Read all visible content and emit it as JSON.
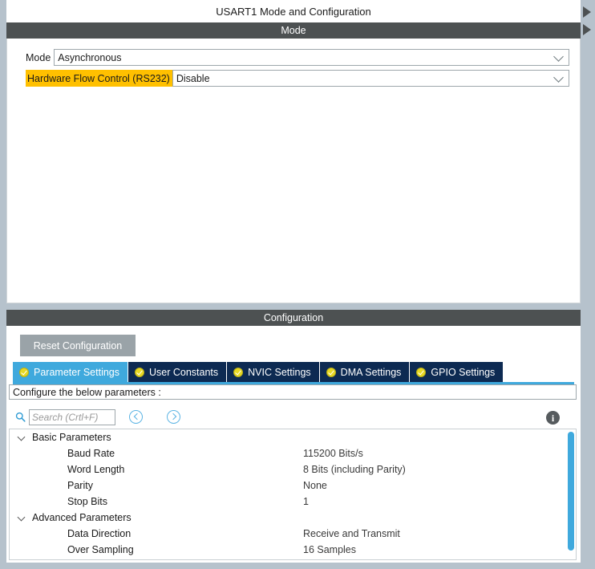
{
  "panel": {
    "title": "USART1 Mode and Configuration"
  },
  "mode_section": {
    "header": "Mode",
    "fields": [
      {
        "label": "Mode",
        "value": "Asynchronous",
        "highlighted": false,
        "arrow_icon": "chevron-down-icon"
      },
      {
        "label": "Hardware Flow Control (RS232)",
        "value": "Disable",
        "highlighted": true,
        "highlight_color": "#ffc000",
        "arrow_icon": "chevron-down-icon"
      }
    ]
  },
  "config_section": {
    "header": "Configuration",
    "reset_button": "Reset Configuration",
    "tabs": [
      {
        "label": "Parameter Settings",
        "active": true,
        "icon": "check-circle-icon"
      },
      {
        "label": "User Constants",
        "active": false,
        "icon": "check-circle-icon"
      },
      {
        "label": "NVIC Settings",
        "active": false,
        "icon": "check-circle-icon"
      },
      {
        "label": "DMA Settings",
        "active": false,
        "icon": "check-circle-icon"
      },
      {
        "label": "GPIO Settings",
        "active": false,
        "icon": "check-circle-icon"
      }
    ],
    "configure_prompt": "Configure the below parameters :",
    "search": {
      "value": "",
      "placeholder": "Search (Crtl+F)",
      "icon": "search-icon",
      "prev_icon": "chevron-left-circle-icon",
      "next_icon": "chevron-right-circle-icon"
    },
    "info_icon_glyph": "i",
    "parameters": [
      {
        "type": "group",
        "name": "Basic Parameters",
        "value": ""
      },
      {
        "type": "item",
        "name": "Baud Rate",
        "value": "115200 Bits/s"
      },
      {
        "type": "item",
        "name": "Word Length",
        "value": "8 Bits (including Parity)"
      },
      {
        "type": "item",
        "name": "Parity",
        "value": "None"
      },
      {
        "type": "item",
        "name": "Stop Bits",
        "value": "1"
      },
      {
        "type": "group",
        "name": "Advanced Parameters",
        "value": ""
      },
      {
        "type": "item",
        "name": "Data Direction",
        "value": "Receive and Transmit"
      },
      {
        "type": "item",
        "name": "Over Sampling",
        "value": "16 Samples"
      }
    ]
  },
  "colors": {
    "section_bar": "#4d5152",
    "active_tab": "#3fa9dd",
    "inactive_tab": "#0d2a52",
    "highlight": "#ffc000",
    "scrollbar_thumb": "#3fa9dd",
    "window_chrome": "#b6c2cc"
  }
}
